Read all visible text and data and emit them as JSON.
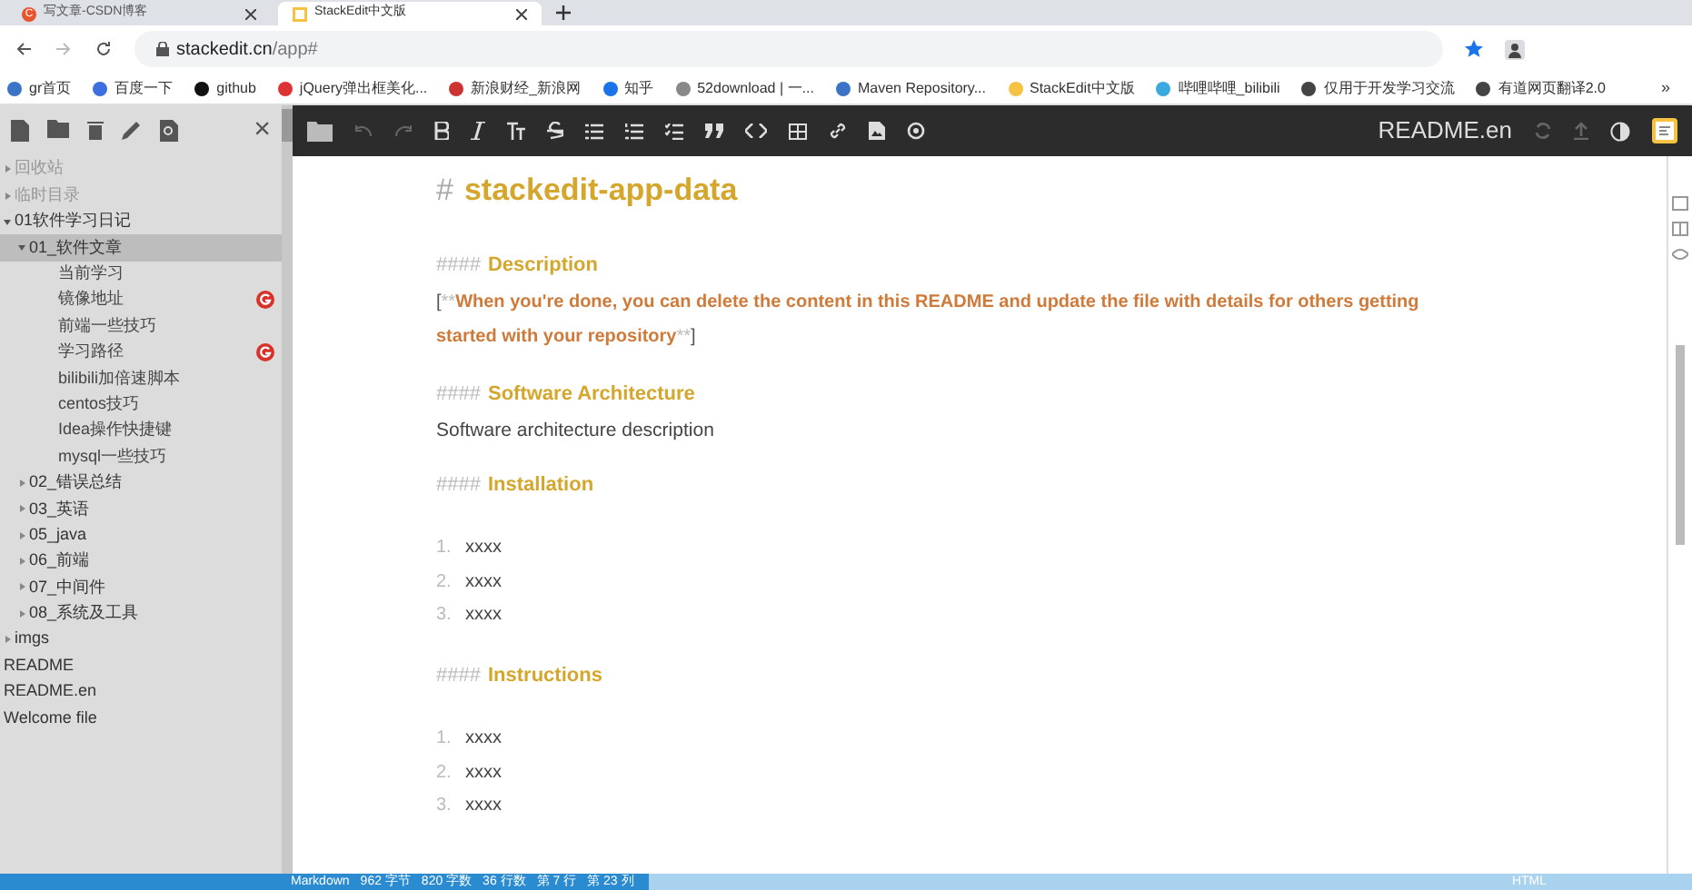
{
  "browser": {
    "tabs": [
      {
        "title": "写文章-CSDN博客",
        "selected": false,
        "icon": "C"
      },
      {
        "title": "StackEdit中文版",
        "selected": true
      }
    ],
    "address": {
      "host": "stackedit.cn",
      "path": "/app#"
    },
    "bookmarks": [
      "gr首页",
      "百度一下",
      "github",
      "jQuery弹出框美化...",
      "新浪财经_新浪网",
      "知乎",
      "52download | 一...",
      "Maven Repository...",
      "StackEdit中文版",
      "哔哩哔哩_bilibili",
      "仅用于开发学习交流",
      "有道网页翻译2.0"
    ],
    "more": "»"
  },
  "sidebar": {
    "close": "×",
    "items": [
      {
        "label": "回收站",
        "kind": "folder",
        "expanded": false,
        "muted": true,
        "selected": false
      },
      {
        "label": "临时目录",
        "kind": "folder",
        "expanded": false,
        "muted": true,
        "selected": false
      },
      {
        "label": "01软件学习日记",
        "kind": "folder",
        "expanded": true,
        "selected": false,
        "children": [
          {
            "label": "01_软件文章",
            "kind": "folder",
            "expanded": true,
            "selected": true,
            "children": [
              {
                "label": "当前学习",
                "kind": "file",
                "synced": false
              },
              {
                "label": "镜像地址",
                "kind": "file",
                "synced": true
              },
              {
                "label": "前端一些技巧",
                "kind": "file",
                "synced": false
              },
              {
                "label": "学习路径",
                "kind": "file",
                "synced": true
              },
              {
                "label": "bilibili加倍速脚本",
                "kind": "file",
                "synced": false
              },
              {
                "label": "centos技巧",
                "kind": "file",
                "synced": false
              },
              {
                "label": "Idea操作快捷键",
                "kind": "file",
                "synced": false
              },
              {
                "label": "mysql一些技巧",
                "kind": "file",
                "synced": false
              }
            ]
          },
          {
            "label": "02_错误总结",
            "kind": "folder",
            "expanded": false,
            "muted": false,
            "selected": false
          },
          {
            "label": "03_英语",
            "kind": "folder",
            "expanded": false,
            "muted": false,
            "selected": false
          },
          {
            "label": "05_java",
            "kind": "folder",
            "expanded": false,
            "muted": false,
            "selected": false
          },
          {
            "label": "06_前端",
            "kind": "folder",
            "expanded": false,
            "muted": false,
            "selected": false
          },
          {
            "label": "07_中间件",
            "kind": "folder",
            "expanded": false,
            "muted": false,
            "selected": false
          },
          {
            "label": "08_系统及工具",
            "kind": "folder",
            "expanded": false,
            "muted": false,
            "selected": false
          }
        ]
      },
      {
        "label": "imgs",
        "kind": "folder",
        "expanded": false,
        "muted": false,
        "selected": false
      },
      {
        "label": "README",
        "kind": "file",
        "synced": false
      },
      {
        "label": "README.en",
        "kind": "file",
        "synced": false
      },
      {
        "label": "Welcome file",
        "kind": "file",
        "synced": false
      }
    ]
  },
  "editor": {
    "title": "README.en",
    "lines": [
      {
        "kind": "h1",
        "mark": "#",
        "text": "stackedit-app-data"
      },
      {
        "kind": "h4",
        "mark": "####",
        "text": "Description"
      },
      {
        "kind": "note",
        "open": "[",
        "mark": "**",
        "text": "When you're done, you can delete the content in this README and update the file with details for others getting started with your repository",
        "close": "]"
      },
      {
        "kind": "h4",
        "mark": "####",
        "text": "Software Architecture"
      },
      {
        "kind": "text",
        "text": "Software architecture description"
      },
      {
        "kind": "h4",
        "mark": "####",
        "text": "Installation"
      },
      {
        "kind": "li",
        "mark": "1.",
        "text": "xxxx"
      },
      {
        "kind": "li",
        "mark": "2.",
        "text": "xxxx"
      },
      {
        "kind": "li",
        "mark": "3.",
        "text": "xxxx"
      },
      {
        "kind": "h4",
        "mark": "####",
        "text": "Instructions"
      },
      {
        "kind": "li",
        "mark": "1.",
        "text": "xxxx"
      },
      {
        "kind": "li",
        "mark": "2.",
        "text": "xxxx"
      },
      {
        "kind": "li",
        "mark": "3.",
        "text": "xxxx"
      }
    ]
  },
  "status_bar": {
    "left": [
      "Markdown",
      "962 字节",
      "820 字数",
      "36 行数",
      "第 7 行",
      "第 23 列"
    ],
    "right": [
      "HTML"
    ]
  }
}
